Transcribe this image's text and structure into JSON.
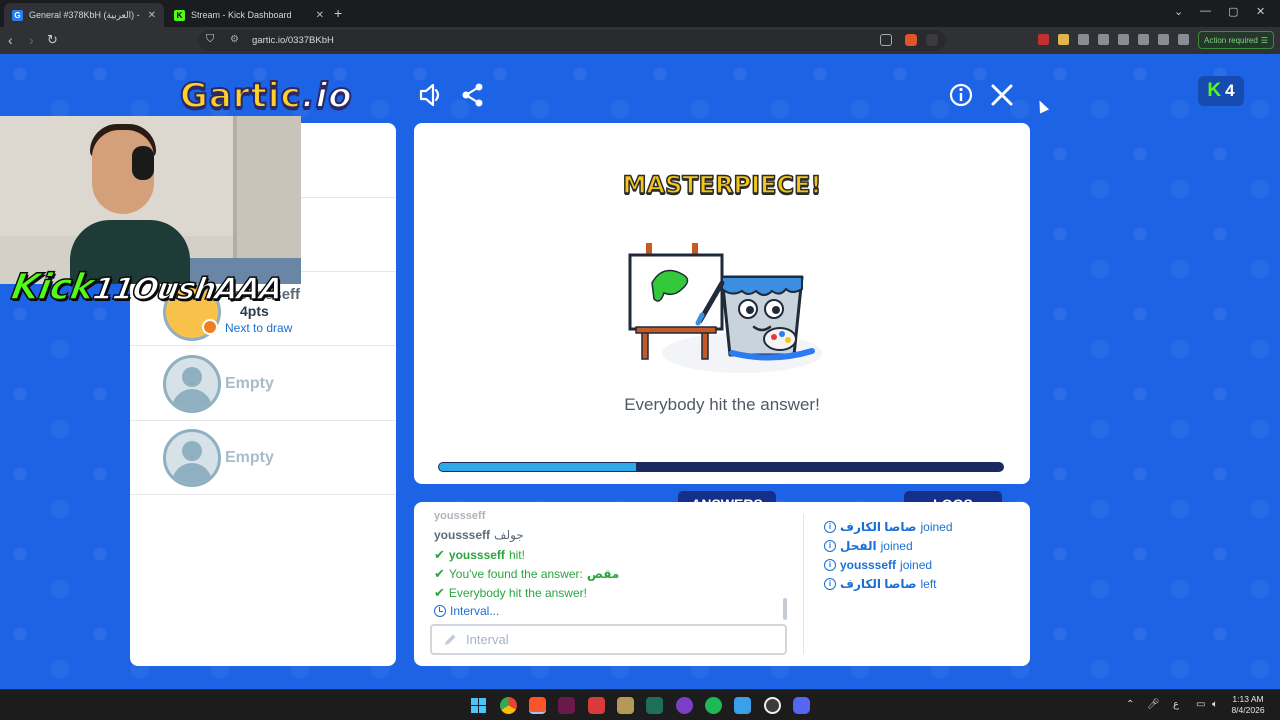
{
  "browser": {
    "tabs": [
      {
        "title": "General #378KbH (العربية) - Gart",
        "active": true
      },
      {
        "title": "Stream - Kick Dashboard",
        "active": false
      }
    ],
    "url": "gartic.io/0337BKbH",
    "action_required": "Action required"
  },
  "game": {
    "logo_main": "Gartic",
    "logo_suffix": ".io",
    "kick_count": "4",
    "players": [
      {
        "name": "youssseff",
        "points": "4pts",
        "status": "Next to draw"
      },
      {
        "name": "Empty"
      },
      {
        "name": "Empty"
      }
    ],
    "result_title": "MASTERPIECE!",
    "result_message": "Everybody hit the answer!",
    "timer_progress": 0.35,
    "answers_tab": "ANSWERS",
    "logs_tab": "LOGS",
    "answers": [
      {
        "name": "youssseff",
        "text": "جولف",
        "type": "guess"
      },
      {
        "name": "youssseff",
        "text": "hit!",
        "type": "hit"
      },
      {
        "text": "You've found the answer:",
        "word": "مقص",
        "type": "found"
      },
      {
        "text": "Everybody hit the answer!",
        "type": "ok"
      },
      {
        "text": "Interval...",
        "type": "interval"
      }
    ],
    "answer_input_placeholder": "Interval",
    "logs": [
      {
        "name": "صاصا الكارف",
        "action": "joined"
      },
      {
        "name": "الفحل",
        "action": "joined"
      },
      {
        "name": "youssseff",
        "action": "joined"
      },
      {
        "name": "صاصا الكارف",
        "action": "left"
      }
    ],
    "colors": {
      "background": "#1c63e6",
      "accent": "#f5c517",
      "tab": "#162f8a",
      "success": "#2aa63f",
      "info": "#1a6fd6"
    }
  },
  "overlay": {
    "streamer_tag_prefix": "Kick",
    "streamer_tag_name": "11OushAAA"
  },
  "taskbar": {
    "time": "1:13 AM",
    "date": "8/4/2026",
    "lang": "ع"
  }
}
